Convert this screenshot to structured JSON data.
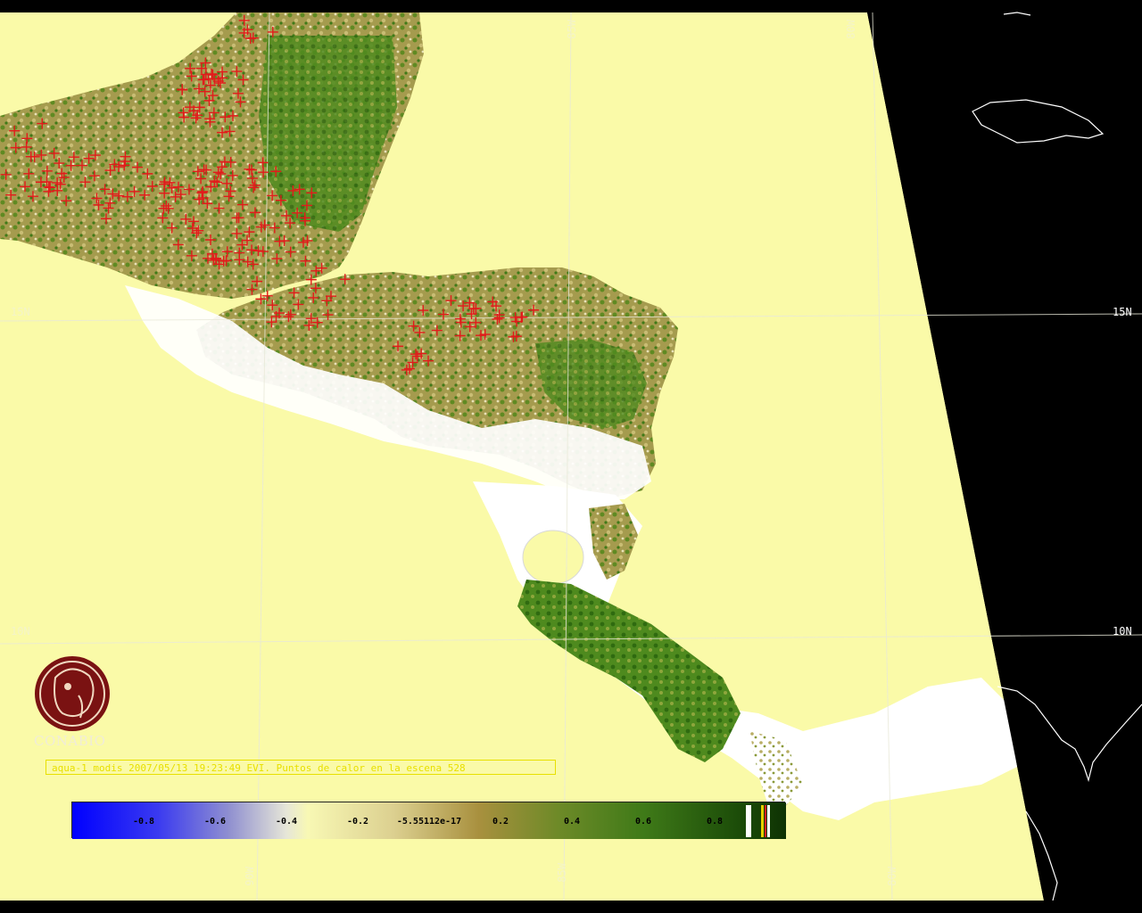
{
  "map": {
    "grid_labels": {
      "lat_15_left": "15N",
      "lat_15_right": "15N",
      "lat_10_left": "10N",
      "lat_10_right": "10N",
      "lon_85_top": "85W",
      "lon_80_top": "80W",
      "lon_90_bottom": "90W",
      "lon_85_bottom": "85W",
      "lon_80_bottom": "80W"
    },
    "colors": {
      "ocean": "#fafaa8",
      "night": "#000000",
      "cloud": "#ffffff",
      "veg_dark": "#3f7a18",
      "veg_mid": "#8c9a3c",
      "veg_light": "#c9bd74",
      "hotspot": "#e21b1b",
      "coastline": "#ffffff"
    }
  },
  "logo": {
    "text": "CONABIO"
  },
  "caption": {
    "text": "aqua-1 modis 2007/05/13 19:23:49 EVI. Puntos de calor en la escena 528"
  },
  "colorbar": {
    "tick_labels": [
      "-0.8",
      "-0.6",
      "-0.4",
      "-0.2",
      "-5.55112e-17",
      "0.2",
      "0.4",
      "0.6",
      "0.8"
    ]
  }
}
